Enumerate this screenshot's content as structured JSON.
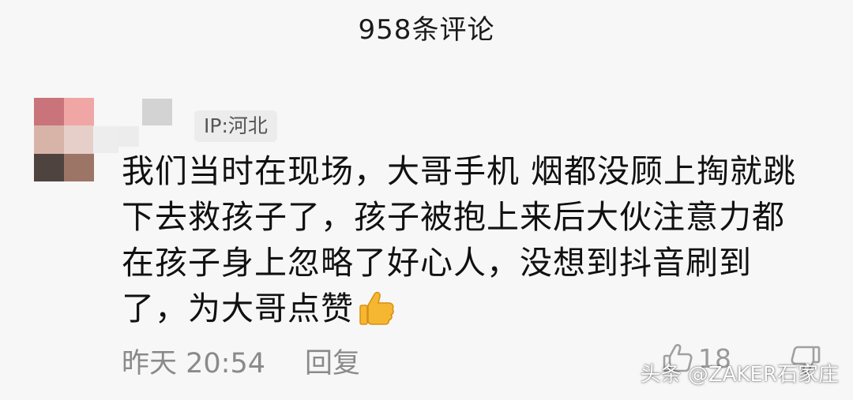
{
  "header": {
    "title": "958条评论"
  },
  "comment": {
    "avatar_icon": "avatar-icon",
    "avatar_colors": [
      "#c9747a",
      "#f0a6a4",
      "#d8b4a8",
      "#e6cfc8",
      "#4e433f",
      "#9c7566"
    ],
    "ip_location": "IP:河北",
    "text_lines": [
      "我们当时在现场，大哥手机 烟都没顾上掏就跳",
      "下去救孩子了，孩子被抱上来后大伙注意力都",
      "在孩子身上忽略了好心人，没想到抖音刷到",
      "了，为大哥点赞"
    ],
    "emoji": "thumbs-up-emoji",
    "timestamp": "昨天 20:54",
    "reply_label": "回复",
    "like_count": "18",
    "like_icon": "thumbs-up-icon",
    "dislike_icon": "thumbs-down-icon"
  },
  "watermark": {
    "text": "头条 @ZAKER石家庄"
  }
}
